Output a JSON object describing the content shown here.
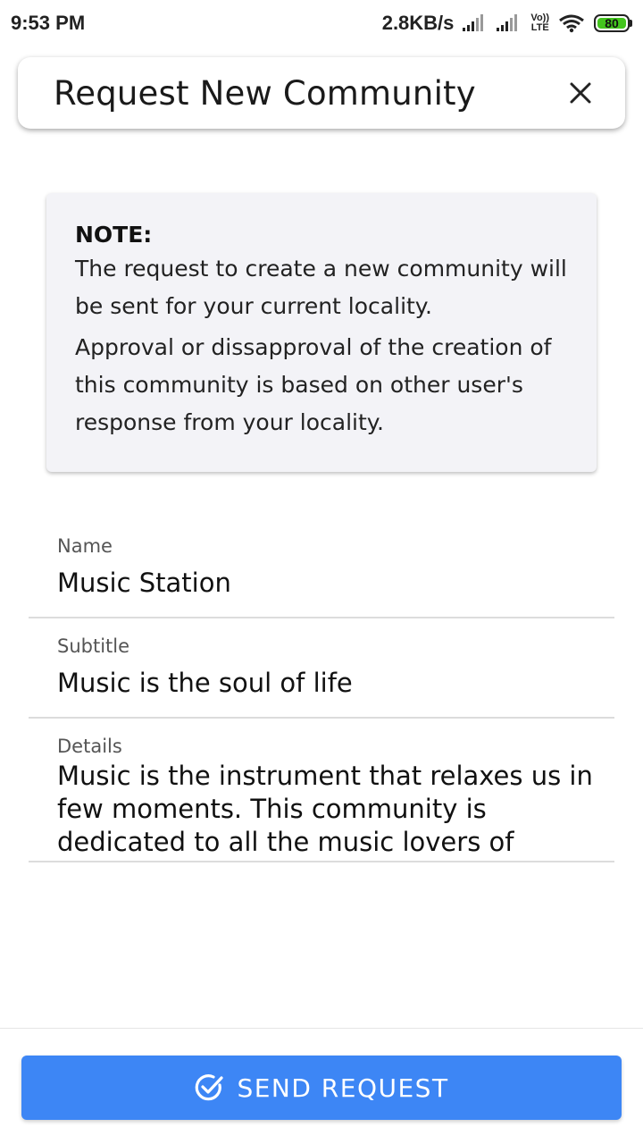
{
  "status_bar": {
    "time": "9:53 PM",
    "network_speed": "2.8KB/s",
    "volte_top": "Vo))",
    "volte_bottom": "LTE",
    "battery": "80",
    "icons": [
      "signal-icon",
      "signal-icon",
      "volte-icon",
      "wifi-icon",
      "battery-icon"
    ]
  },
  "header": {
    "title": "Request New Community",
    "close_icon": "close-icon"
  },
  "note": {
    "heading": "NOTE:",
    "line1": "The request to create a new community will be sent for your current locality.",
    "line2": "Approval or dissapproval of the creation of this community is based on other user's response from your locality."
  },
  "form": {
    "name": {
      "label": "Name",
      "value": "Music Station"
    },
    "subtitle": {
      "label": "Subtitle",
      "value": "Music is the soul of life"
    },
    "details": {
      "label": "Details",
      "value": "Music is the instrument that relaxes us in few moments. This community is dedicated to all the music lovers of"
    }
  },
  "action": {
    "send_label": "SEND REQUEST",
    "icon": "check-circle-icon"
  },
  "colors": {
    "accent": "#3d86f5",
    "battery": "#43c51d",
    "note_bg": "#f3f3f7"
  }
}
